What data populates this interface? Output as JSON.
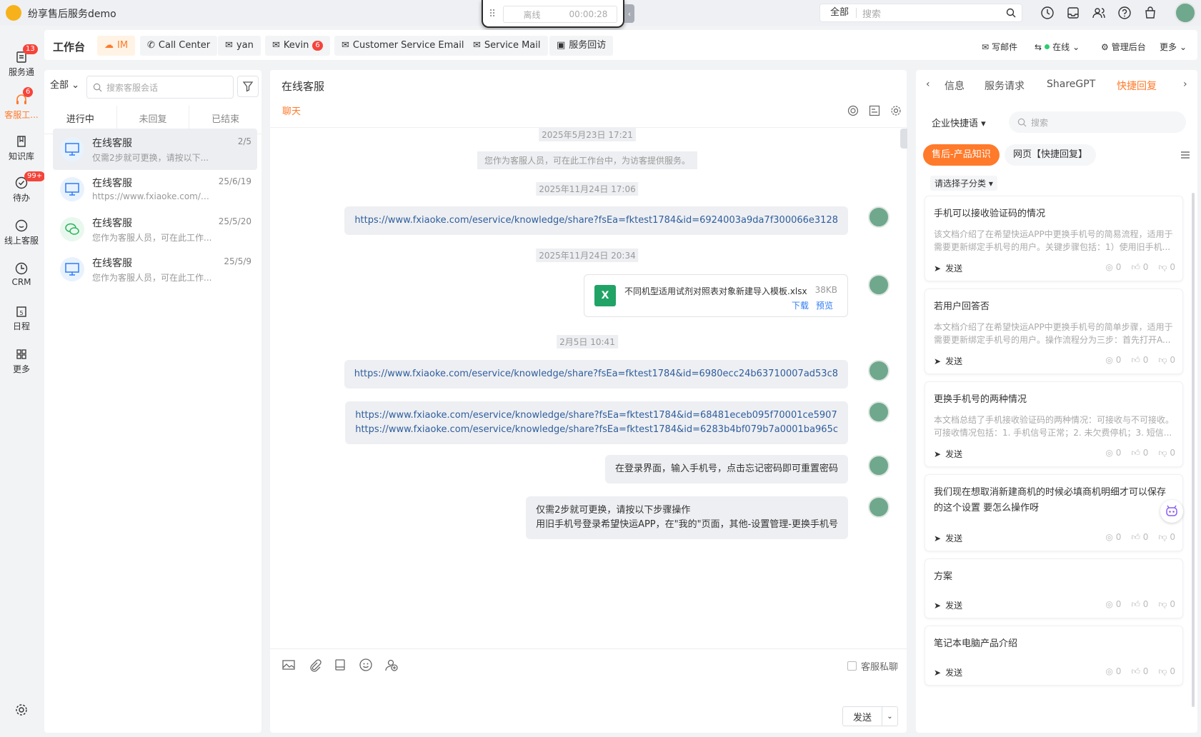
{
  "app": {
    "name": "纷享售后服务demo"
  },
  "callbar": {
    "status": "离线",
    "timer": "00:00:28"
  },
  "search": {
    "scope": "全部",
    "placeholder": "搜索"
  },
  "leftnav": [
    {
      "label": "服务通",
      "badge": "13",
      "icon": "service-icon"
    },
    {
      "label": "客服工...",
      "badge": "6",
      "icon": "headset-icon",
      "active": true
    },
    {
      "label": "知识库",
      "icon": "book-icon"
    },
    {
      "label": "待办",
      "badge": "99+",
      "icon": "todo-icon"
    },
    {
      "label": "线上客服",
      "icon": "chat-icon"
    },
    {
      "label": "CRM",
      "icon": "crm-icon"
    },
    {
      "label": "日程",
      "icon": "calendar-icon"
    },
    {
      "label": "更多",
      "icon": "grid-icon"
    }
  ],
  "tabs": {
    "title": "工作台",
    "items": [
      {
        "label": "IM"
      },
      {
        "label": "Call Center"
      },
      {
        "label": "yan"
      },
      {
        "label": "Kevin",
        "count": "6"
      },
      {
        "label": "Customer Service Email"
      },
      {
        "label": "Service Mail"
      },
      {
        "label": "服务回访"
      }
    ],
    "right": {
      "compose": "写邮件",
      "status": "在线",
      "admin": "管理后台",
      "more": "更多"
    }
  },
  "conversations": {
    "filter": "全部",
    "search_placeholder": "搜索客服会话",
    "subtabs": [
      "进行中",
      "未回复",
      "已结束"
    ],
    "items": [
      {
        "name": "在线客服",
        "date": "2/5",
        "preview": "仅需2步就可更换，请按以下..."
      },
      {
        "name": "在线客服",
        "date": "25/6/19",
        "preview": "https://www.fxiaoke.com/eser..."
      },
      {
        "name": "在线客服",
        "date": "25/5/20",
        "preview": "您作为客服人员，可在此工作..."
      },
      {
        "name": "在线客服",
        "date": "25/5/9",
        "preview": "您作为客服人员，可在此工作..."
      }
    ]
  },
  "chat": {
    "title": "在线客服",
    "subtab": "聊天",
    "timestamps": [
      "2025年5月23日 17:21",
      "2025年11月24日 17:06",
      "2025年11月24日 20:34",
      "2月5日 10:41"
    ],
    "system": "您作为客服人员，可在此工作台中，为访客提供服务。",
    "link1": "https://www.fxiaoke.com/eservice/knowledge/share?fsEa=fktest1784&id=6924003a9da7f300066e3128",
    "file": {
      "name": "不同机型适用试剂对照表对象新建导入模板.xlsx",
      "size": "38KB",
      "download": "下载",
      "preview": "预览",
      "icon": "X"
    },
    "link2": "https://www.fxiaoke.com/eservice/knowledge/share?fsEa=fktest1784&id=6980ecc24b63710007ad53c8",
    "link3a": "https://www.fxiaoke.com/eservice/knowledge/share?fsEa=fktest1784&id=68481eceb095f70001ce5907",
    "link3b": "https://www.fxiaoke.com/eservice/knowledge/share?fsEa=fktest1784&id=6283b4bf079b7a0001ba965c",
    "text1": "在登录界面，输入手机号，点击忘记密码即可重置密码",
    "text2a": "仅需2步就可更换，请按以下步骤操作",
    "text2b": "用旧手机号登录希望快运APP，在\"我的\"页面，其他-设置管理-更换手机号",
    "private_label": "客服私聊",
    "send": "发送"
  },
  "right": {
    "tabs": [
      "信息",
      "服务请求",
      "ShareGPT",
      "快捷回复"
    ],
    "kb_select": "企业快捷语",
    "search_placeholder": "搜索",
    "chips": [
      "售后-产品知识",
      "网页【快捷回复】"
    ],
    "subcat": "请选择子分类",
    "cards": [
      {
        "title": "手机可以接收验证码的情况",
        "desc": "该文档介绍了在希望快运APP中更换手机号的简易流程，适用于需要更新绑定手机号的用户。关键步骤包括：1）使用旧手机...",
        "send": "发送",
        "views": "0",
        "likes": "0",
        "dislikes": "0"
      },
      {
        "title": "若用户回答否",
        "desc": "本文档介绍了在希望快运APP中更换手机号的简单步骤，适用于需要更新绑定手机号的用户。操作流程分为三步：首先打开A...",
        "send": "发送",
        "views": "0",
        "likes": "0",
        "dislikes": "0"
      },
      {
        "title": "更换手机号的两种情况",
        "desc": "本文档总结了手机接收验证码的两种情况：可接收与不可接收。可接收情况包括：1. 手机信号正常；2. 未欠费停机；3. 短信...",
        "send": "发送",
        "views": "0",
        "likes": "0",
        "dislikes": "0"
      },
      {
        "title": "我们现在想取消新建商机的时候必填商机明细才可以保存的这个设置 要怎么操作呀",
        "desc": "",
        "send": "发送",
        "views": "0",
        "likes": "0",
        "dislikes": "0"
      },
      {
        "title": "方案",
        "desc": "",
        "send": "发送",
        "views": "0",
        "likes": "0",
        "dislikes": "0"
      },
      {
        "title": "笔记本电脑产品介绍",
        "desc": "",
        "send": "发送",
        "views": "0",
        "likes": "0",
        "dislikes": "0"
      }
    ]
  }
}
